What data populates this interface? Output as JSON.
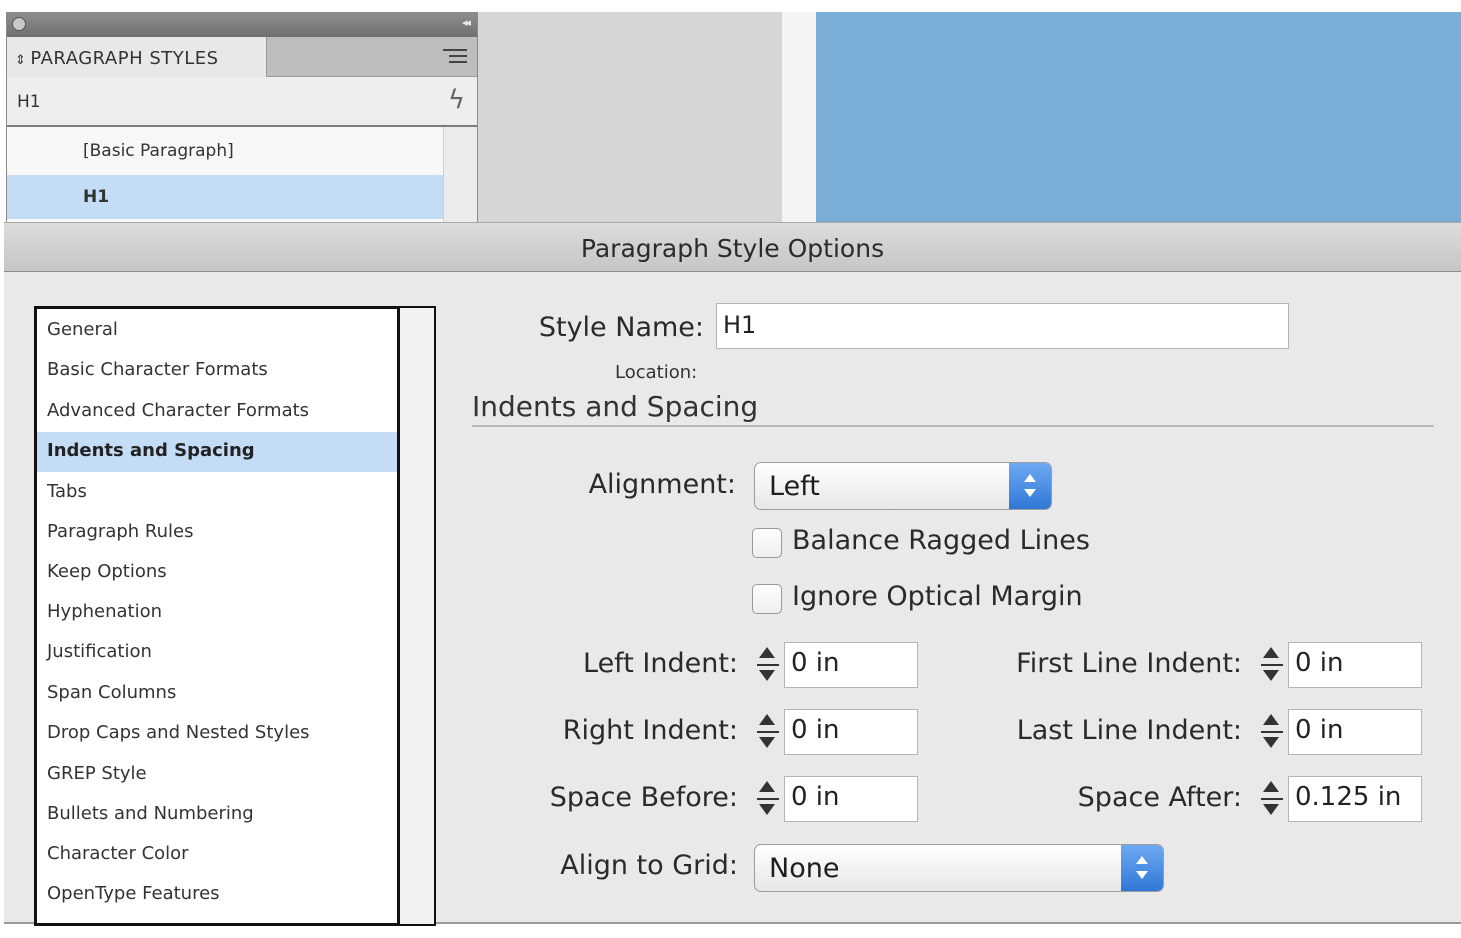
{
  "panel": {
    "title": "PARAGRAPH STYLES",
    "title_prefix": "⇕",
    "current_style": "H1",
    "lightning_icon": "quick-apply-icon",
    "items": [
      {
        "label": "[Basic Paragraph]",
        "selected": false
      },
      {
        "label": "H1",
        "selected": true
      }
    ]
  },
  "dialog": {
    "title": "Paragraph Style Options",
    "categories": [
      "General",
      "Basic Character Formats",
      "Advanced Character Formats",
      "Indents and Spacing",
      "Tabs",
      "Paragraph Rules",
      "Keep Options",
      "Hyphenation",
      "Justification",
      "Span Columns",
      "Drop Caps and Nested Styles",
      "GREP Style",
      "Bullets and Numbering",
      "Character Color",
      "OpenType Features"
    ],
    "selected_category": "Indents and Spacing",
    "style_name_label": "Style Name:",
    "style_name_value": "H1",
    "location_label": "Location:",
    "section_title": "Indents and Spacing",
    "alignment": {
      "label": "Alignment:",
      "value": "Left"
    },
    "balance_ragged": {
      "label": "Balance Ragged Lines",
      "checked": false
    },
    "ignore_optical": {
      "label": "Ignore Optical Margin",
      "checked": false
    },
    "left_indent": {
      "label": "Left Indent:",
      "value": "0 in"
    },
    "first_line_indent": {
      "label": "First Line Indent:",
      "value": "0 in"
    },
    "right_indent": {
      "label": "Right Indent:",
      "value": "0 in"
    },
    "last_line_indent": {
      "label": "Last Line Indent:",
      "value": "0 in"
    },
    "space_before": {
      "label": "Space Before:",
      "value": "0 in"
    },
    "space_after": {
      "label": "Space After:",
      "value": "0.125 in"
    },
    "align_to_grid": {
      "label": "Align to Grid:",
      "value": "None"
    }
  },
  "colors": {
    "selection": "#c4dcf6",
    "canvas_blue": "#7aaed6",
    "popup_arrow": "#2f77d6"
  }
}
